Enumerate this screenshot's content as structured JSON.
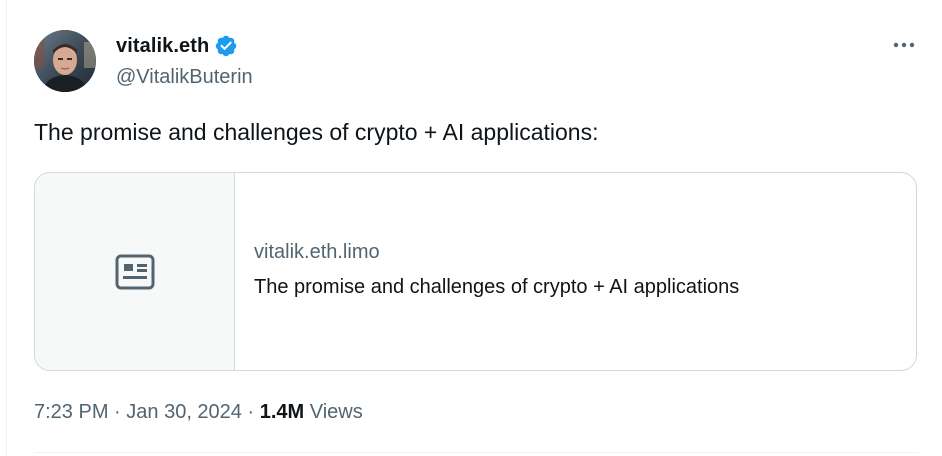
{
  "author": {
    "display_name": "vitalik.eth",
    "handle": "@VitalikButerin",
    "verified": true
  },
  "tweet": {
    "text": "The promise and challenges of crypto + AI applications:"
  },
  "link_card": {
    "domain": "vitalik.eth.limo",
    "title": "The promise and challenges of crypto + AI applications",
    "thumbnail_icon": "article-icon"
  },
  "meta": {
    "time": "7:23 PM",
    "separator": " · ",
    "date": "Jan 30, 2024",
    "views_count": "1.4M",
    "views_label": "Views"
  },
  "icons": {
    "verified": "verified-badge-icon",
    "more": "more-options-icon"
  },
  "colors": {
    "text_primary": "#0f1419",
    "text_secondary": "#536471",
    "border": "#cfd9de",
    "verified_blue": "#1d9bf0"
  }
}
